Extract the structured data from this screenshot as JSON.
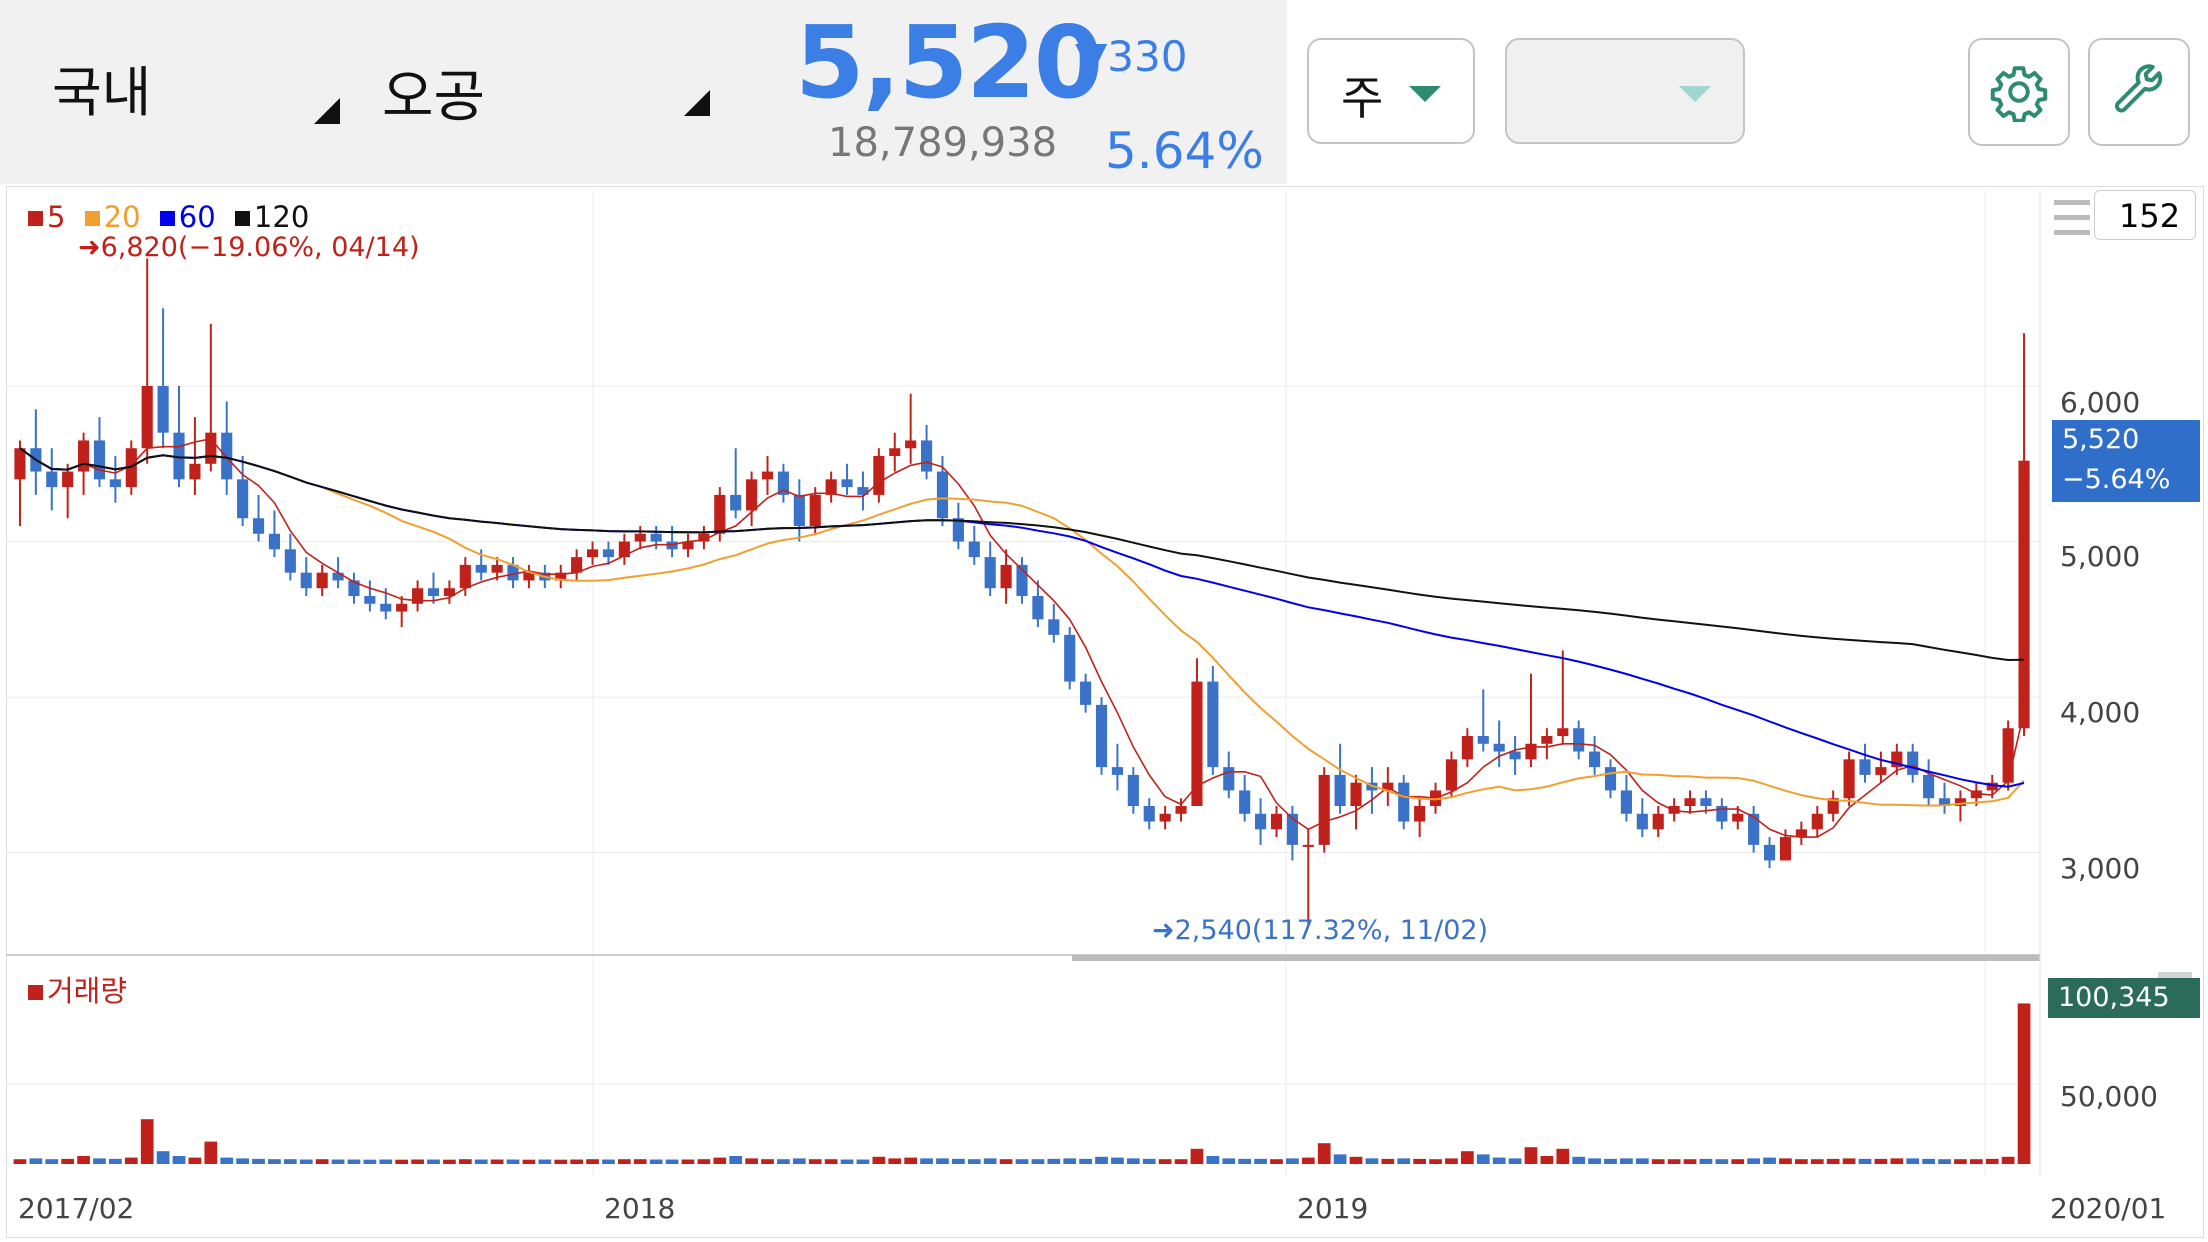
{
  "header": {
    "market": "국내",
    "stock_name": "오공",
    "price": "5,520",
    "change": "▼330",
    "volume": "18,789,938",
    "change_pct": "5.64%",
    "period_select": "주",
    "secondary_select": "",
    "accent_color": "#3a7ee6",
    "select_arrow_color": "#2e8b72"
  },
  "icons": [
    "gear-icon",
    "wrench-icon",
    "menu-icon",
    "close-icon"
  ],
  "chart": {
    "zoom_value": "152",
    "legend": [
      {
        "label": "5",
        "color": "#c0221b"
      },
      {
        "label": "20",
        "color": "#f0a030"
      },
      {
        "label": "60",
        "color": "#0000ee"
      },
      {
        "label": "120",
        "color": "#111111"
      }
    ],
    "high_annotation": "➜6,820(−19.06%, 04/14)",
    "low_annotation": "➜2,540(117.32%, 11/02)",
    "price_tag": "5,520",
    "price_tag_pct": "−5.64%",
    "volume_title": "거래량",
    "volume_tag": "100,345",
    "y_ticks": [
      "6,000",
      "5,000",
      "4,000",
      "3,000"
    ],
    "volume_ticks": [
      "50,000"
    ],
    "x_ticks": [
      "2017/02",
      "2018",
      "2019",
      "2020/01"
    ],
    "up_color": "#c0221b",
    "down_color": "#3a72c8"
  },
  "chart_data": {
    "type": "candlestick",
    "price_ylim": [
      2400,
      6900
    ],
    "volume_ylim": [
      0,
      105000
    ],
    "x_range": [
      "2017/02",
      "2020/01"
    ],
    "candles_ohlc": [
      [
        5400,
        5650,
        5100,
        5600
      ],
      [
        5600,
        5850,
        5300,
        5450
      ],
      [
        5450,
        5600,
        5200,
        5350
      ],
      [
        5350,
        5500,
        5150,
        5450
      ],
      [
        5450,
        5700,
        5300,
        5650
      ],
      [
        5650,
        5800,
        5350,
        5400
      ],
      [
        5400,
        5550,
        5250,
        5350
      ],
      [
        5350,
        5650,
        5300,
        5600
      ],
      [
        5600,
        6820,
        5500,
        6000
      ],
      [
        6000,
        6500,
        5600,
        5700
      ],
      [
        5700,
        6000,
        5350,
        5400
      ],
      [
        5400,
        5800,
        5300,
        5500
      ],
      [
        5500,
        6400,
        5450,
        5700
      ],
      [
        5700,
        5900,
        5300,
        5400
      ],
      [
        5400,
        5550,
        5100,
        5150
      ],
      [
        5150,
        5300,
        5000,
        5050
      ],
      [
        5050,
        5200,
        4900,
        4950
      ],
      [
        4950,
        5050,
        4750,
        4800
      ],
      [
        4800,
        4900,
        4650,
        4700
      ],
      [
        4700,
        4850,
        4650,
        4800
      ],
      [
        4800,
        4900,
        4700,
        4750
      ],
      [
        4750,
        4800,
        4600,
        4650
      ],
      [
        4650,
        4750,
        4550,
        4600
      ],
      [
        4600,
        4700,
        4500,
        4550
      ],
      [
        4550,
        4650,
        4450,
        4600
      ],
      [
        4600,
        4750,
        4550,
        4700
      ],
      [
        4700,
        4800,
        4600,
        4650
      ],
      [
        4650,
        4750,
        4600,
        4700
      ],
      [
        4700,
        4900,
        4650,
        4850
      ],
      [
        4850,
        4950,
        4750,
        4800
      ],
      [
        4800,
        4900,
        4750,
        4850
      ],
      [
        4850,
        4900,
        4700,
        4750
      ],
      [
        4750,
        4850,
        4700,
        4800
      ],
      [
        4800,
        4850,
        4700,
        4750
      ],
      [
        4750,
        4850,
        4700,
        4800
      ],
      [
        4800,
        4950,
        4750,
        4900
      ],
      [
        4900,
        5000,
        4850,
        4950
      ],
      [
        4950,
        5000,
        4850,
        4900
      ],
      [
        4900,
        5050,
        4850,
        5000
      ],
      [
        5000,
        5100,
        4950,
        5050
      ],
      [
        5050,
        5100,
        4950,
        5000
      ],
      [
        5000,
        5100,
        4900,
        4950
      ],
      [
        4950,
        5050,
        4900,
        5000
      ],
      [
        5000,
        5100,
        4950,
        5050
      ],
      [
        5050,
        5350,
        5000,
        5300
      ],
      [
        5300,
        5600,
        5150,
        5200
      ],
      [
        5200,
        5450,
        5100,
        5400
      ],
      [
        5400,
        5550,
        5300,
        5450
      ],
      [
        5450,
        5500,
        5250,
        5300
      ],
      [
        5300,
        5400,
        5000,
        5100
      ],
      [
        5100,
        5350,
        5050,
        5300
      ],
      [
        5300,
        5450,
        5250,
        5400
      ],
      [
        5400,
        5500,
        5300,
        5350
      ],
      [
        5350,
        5450,
        5200,
        5300
      ],
      [
        5300,
        5600,
        5250,
        5550
      ],
      [
        5550,
        5700,
        5450,
        5600
      ],
      [
        5600,
        5950,
        5500,
        5650
      ],
      [
        5650,
        5750,
        5400,
        5450
      ],
      [
        5450,
        5550,
        5100,
        5150
      ],
      [
        5150,
        5250,
        4950,
        5000
      ],
      [
        5000,
        5100,
        4850,
        4900
      ],
      [
        4900,
        5000,
        4650,
        4700
      ],
      [
        4700,
        4950,
        4600,
        4850
      ],
      [
        4850,
        4900,
        4600,
        4650
      ],
      [
        4650,
        4750,
        4450,
        4500
      ],
      [
        4500,
        4600,
        4350,
        4400
      ],
      [
        4400,
        4450,
        4050,
        4100
      ],
      [
        4100,
        4150,
        3900,
        3950
      ],
      [
        3950,
        4000,
        3500,
        3550
      ],
      [
        3550,
        3700,
        3400,
        3500
      ],
      [
        3500,
        3550,
        3250,
        3300
      ],
      [
        3300,
        3350,
        3150,
        3200
      ],
      [
        3200,
        3300,
        3150,
        3250
      ],
      [
        3250,
        3350,
        3200,
        3300
      ],
      [
        3300,
        4250,
        3300,
        4100
      ],
      [
        4100,
        4200,
        3500,
        3550
      ],
      [
        3550,
        3650,
        3350,
        3400
      ],
      [
        3400,
        3500,
        3200,
        3250
      ],
      [
        3250,
        3350,
        3050,
        3150
      ],
      [
        3150,
        3300,
        3100,
        3250
      ],
      [
        3250,
        3300,
        2950,
        3050
      ],
      [
        3050,
        3150,
        2540,
        3050
      ],
      [
        3050,
        3550,
        3000,
        3500
      ],
      [
        3500,
        3700,
        3250,
        3300
      ],
      [
        3300,
        3500,
        3150,
        3450
      ],
      [
        3450,
        3550,
        3250,
        3400
      ],
      [
        3400,
        3550,
        3300,
        3450
      ],
      [
        3450,
        3500,
        3150,
        3200
      ],
      [
        3200,
        3350,
        3100,
        3300
      ],
      [
        3300,
        3450,
        3250,
        3400
      ],
      [
        3400,
        3650,
        3350,
        3600
      ],
      [
        3600,
        3800,
        3550,
        3750
      ],
      [
        3750,
        4050,
        3650,
        3700
      ],
      [
        3700,
        3850,
        3550,
        3650
      ],
      [
        3650,
        3750,
        3500,
        3600
      ],
      [
        3600,
        4150,
        3550,
        3700
      ],
      [
        3700,
        3800,
        3600,
        3750
      ],
      [
        3750,
        4300,
        3700,
        3800
      ],
      [
        3800,
        3850,
        3600,
        3650
      ],
      [
        3650,
        3750,
        3500,
        3550
      ],
      [
        3550,
        3600,
        3350,
        3400
      ],
      [
        3400,
        3500,
        3200,
        3250
      ],
      [
        3250,
        3350,
        3100,
        3150
      ],
      [
        3150,
        3300,
        3100,
        3250
      ],
      [
        3250,
        3350,
        3200,
        3300
      ],
      [
        3300,
        3400,
        3250,
        3350
      ],
      [
        3350,
        3400,
        3250,
        3300
      ],
      [
        3300,
        3350,
        3150,
        3200
      ],
      [
        3200,
        3300,
        3150,
        3250
      ],
      [
        3250,
        3300,
        3000,
        3050
      ],
      [
        3050,
        3100,
        2900,
        2950
      ],
      [
        2950,
        3150,
        2950,
        3100
      ],
      [
        3100,
        3200,
        3050,
        3150
      ],
      [
        3150,
        3300,
        3100,
        3250
      ],
      [
        3250,
        3400,
        3200,
        3350
      ],
      [
        3350,
        3650,
        3300,
        3600
      ],
      [
        3600,
        3700,
        3450,
        3500
      ],
      [
        3500,
        3650,
        3450,
        3550
      ],
      [
        3550,
        3700,
        3500,
        3650
      ],
      [
        3650,
        3700,
        3450,
        3500
      ],
      [
        3500,
        3600,
        3300,
        3350
      ],
      [
        3350,
        3450,
        3250,
        3300
      ],
      [
        3300,
        3400,
        3200,
        3350
      ],
      [
        3350,
        3450,
        3300,
        3400
      ],
      [
        3400,
        3500,
        3350,
        3450
      ],
      [
        3450,
        3850,
        3400,
        3800
      ],
      [
        3800,
        6340,
        3750,
        5520
      ]
    ],
    "volume": [
      3000,
      3500,
      3000,
      3200,
      5000,
      3500,
      3200,
      4000,
      28000,
      8000,
      5000,
      4000,
      14000,
      4000,
      3500,
      3200,
      3000,
      3000,
      2800,
      3000,
      2800,
      2800,
      2700,
      2800,
      2700,
      2800,
      2800,
      2700,
      3000,
      2800,
      2800,
      2800,
      2700,
      2800,
      2700,
      2800,
      3000,
      2800,
      3000,
      3000,
      2800,
      2800,
      2800,
      3000,
      4000,
      5000,
      3500,
      3000,
      3000,
      3500,
      3000,
      3000,
      2800,
      2800,
      4500,
      3500,
      4000,
      3500,
      3500,
      3200,
      3000,
      3500,
      3000,
      3000,
      3000,
      3200,
      3500,
      3200,
      4500,
      4000,
      3500,
      3200,
      3000,
      3000,
      9500,
      5000,
      3500,
      3200,
      3200,
      3000,
      3500,
      4000,
      13000,
      6000,
      4500,
      3500,
      3200,
      3500,
      3200,
      3000,
      3500,
      8000,
      6000,
      4000,
      3500,
      10500,
      5000,
      9500,
      4500,
      3500,
      3200,
      3500,
      3500,
      3000,
      3000,
      3000,
      3200,
      3000,
      3000,
      3500,
      4000,
      3500,
      3000,
      3000,
      3200,
      3500,
      3200,
      3200,
      3500,
      3500,
      3200,
      3000,
      3000,
      3000,
      3200,
      4500,
      100345
    ]
  }
}
